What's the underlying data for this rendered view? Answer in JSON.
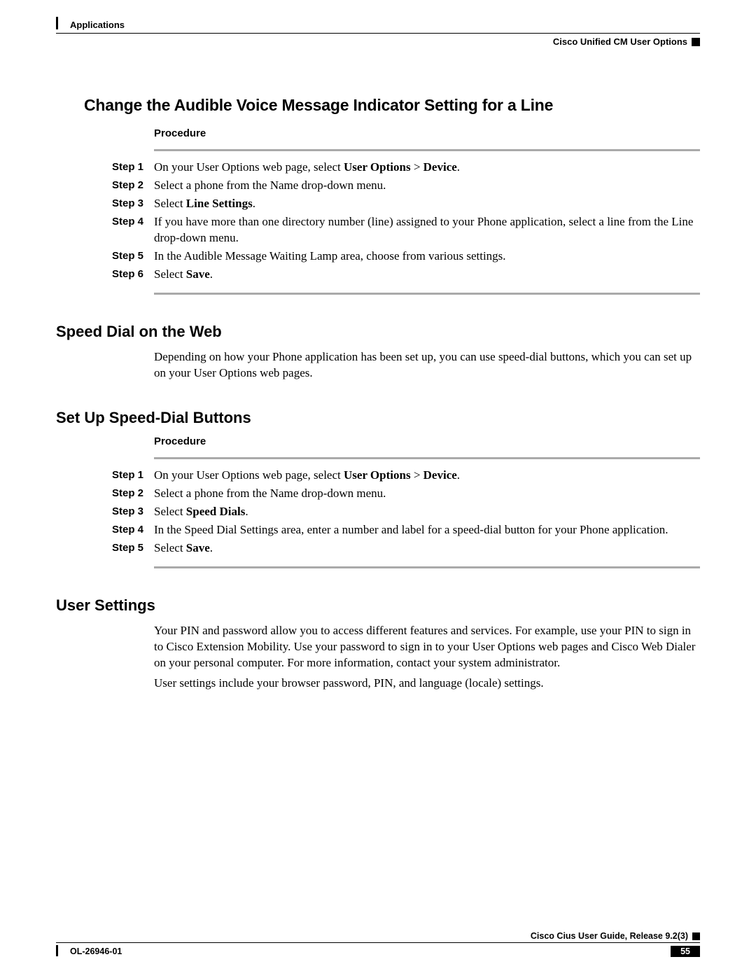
{
  "header": {
    "left": "Applications",
    "right": "Cisco Unified CM User Options"
  },
  "sections": {
    "s1": {
      "title": "Change the Audible Voice Message Indicator Setting for a Line",
      "procedure_label": "Procedure",
      "steps": [
        {
          "label": "Step 1",
          "pre": "On your User Options web page, select ",
          "bold1": "User Options",
          "mid": " > ",
          "bold2": "Device",
          "post": "."
        },
        {
          "label": "Step 2",
          "text": "Select a phone from the Name drop-down menu."
        },
        {
          "label": "Step 3",
          "pre": "Select ",
          "bold1": "Line Settings",
          "post": "."
        },
        {
          "label": "Step 4",
          "text": "If you have more than one directory number (line) assigned to your Phone application, select a line from the Line drop-down menu."
        },
        {
          "label": "Step 5",
          "text": "In the Audible Message Waiting Lamp area, choose from various settings."
        },
        {
          "label": "Step 6",
          "pre": "Select ",
          "bold1": "Save",
          "post": "."
        }
      ]
    },
    "s2": {
      "title": "Speed Dial on the Web",
      "para": "Depending on how your Phone application has been set up, you can use speed-dial buttons, which you can set up on your User Options web pages."
    },
    "s3": {
      "title": "Set Up Speed-Dial Buttons",
      "procedure_label": "Procedure",
      "steps": [
        {
          "label": "Step 1",
          "pre": "On your User Options web page, select ",
          "bold1": "User Options",
          "mid": " > ",
          "bold2": "Device",
          "post": "."
        },
        {
          "label": "Step 2",
          "text": "Select a phone from the Name drop-down menu."
        },
        {
          "label": "Step 3",
          "pre": "Select ",
          "bold1": "Speed Dials",
          "post": "."
        },
        {
          "label": "Step 4",
          "text": "In the Speed Dial Settings area, enter a number and label for a speed-dial button for your Phone application."
        },
        {
          "label": "Step 5",
          "pre": "Select ",
          "bold1": "Save",
          "post": "."
        }
      ]
    },
    "s4": {
      "title": "User Settings",
      "para1": "Your PIN and password allow you to access different features and services. For example, use your PIN to sign in to Cisco Extension Mobility. Use your password to sign in to your User Options web pages and Cisco Web Dialer on your personal computer. For more information, contact your system administrator.",
      "para2": "User settings include your browser password, PIN, and language (locale) settings."
    }
  },
  "footer": {
    "guide": "Cisco Cius User Guide, Release 9.2(3)",
    "doc_id": "OL-26946-01",
    "page": "55"
  }
}
